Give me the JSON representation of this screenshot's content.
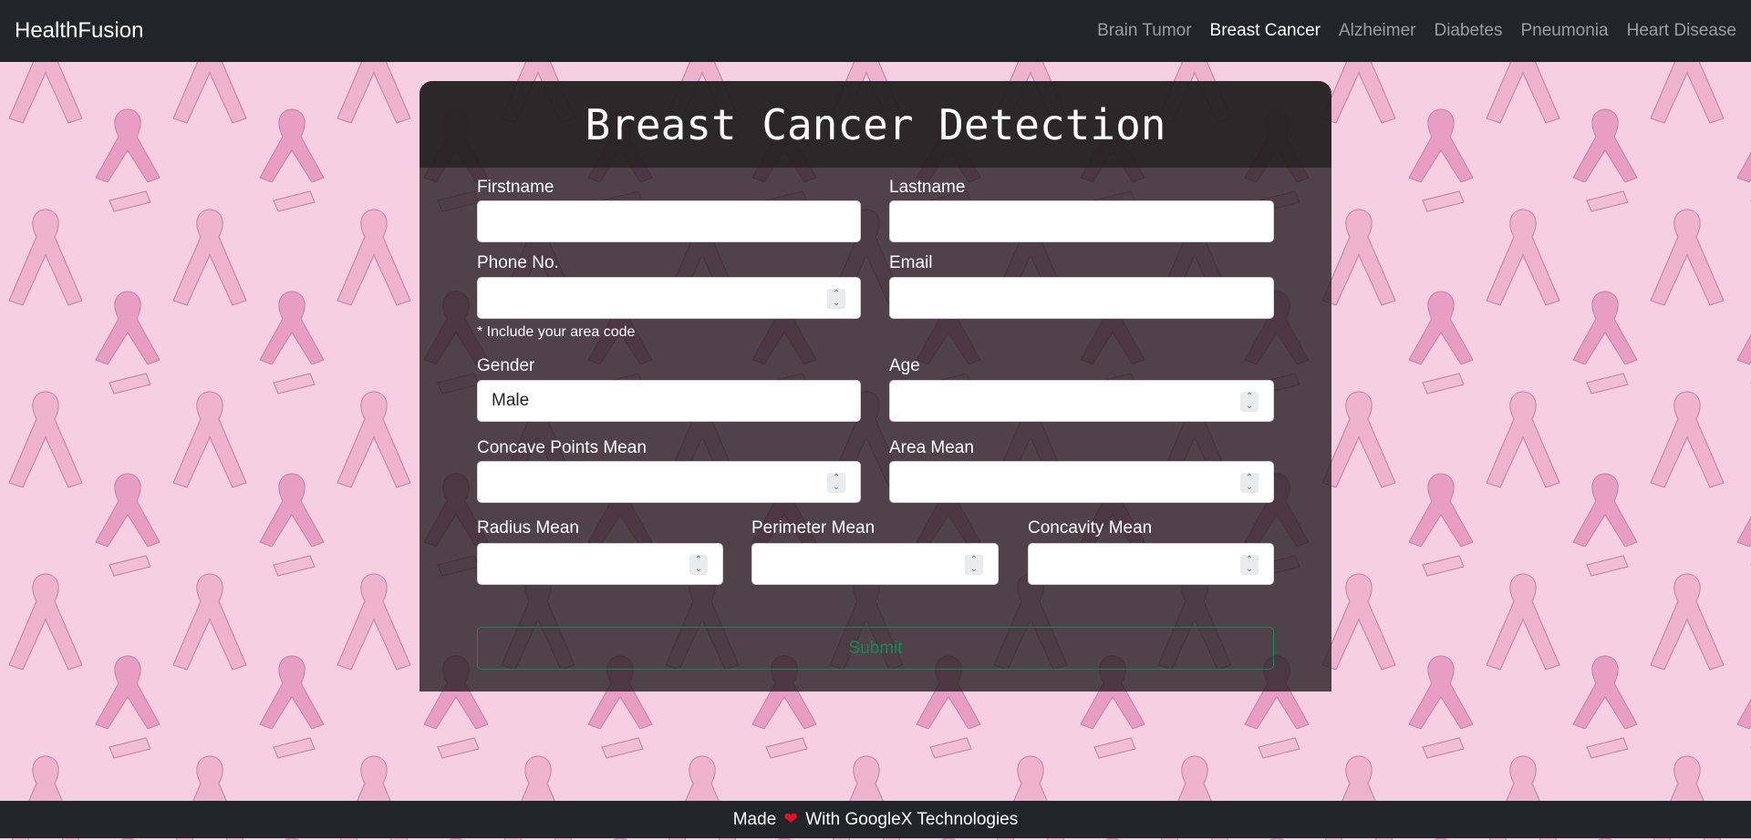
{
  "navbar": {
    "brand": "HealthFusion",
    "links": [
      {
        "label": "Brain Tumor"
      },
      {
        "label": "Breast Cancer",
        "active": true
      },
      {
        "label": "Alzheimer"
      },
      {
        "label": "Diabetes"
      },
      {
        "label": "Pneumonia"
      },
      {
        "label": "Heart Disease"
      }
    ]
  },
  "form": {
    "title": "Breast Cancer Detection",
    "fields": {
      "firstname": {
        "label": "Firstname",
        "value": ""
      },
      "lastname": {
        "label": "Lastname",
        "value": ""
      },
      "phone": {
        "label": "Phone No.",
        "value": "",
        "hint": "* Include your area code"
      },
      "email": {
        "label": "Email",
        "value": ""
      },
      "gender": {
        "label": "Gender",
        "value": "Male"
      },
      "age": {
        "label": "Age",
        "value": ""
      },
      "concave_points_mean": {
        "label": "Concave Points Mean",
        "value": ""
      },
      "area_mean": {
        "label": "Area Mean",
        "value": ""
      },
      "radius_mean": {
        "label": "Radius Mean",
        "value": ""
      },
      "perimeter_mean": {
        "label": "Perimeter Mean",
        "value": ""
      },
      "concavity_mean": {
        "label": "Concavity Mean",
        "value": ""
      }
    },
    "submit_label": "Submit"
  },
  "footer": {
    "made": "Made",
    "heart": "❤",
    "with": "With GoogleX Technologies"
  },
  "colors": {
    "background": "#f6d0e2",
    "ribbon": "#e38fb8",
    "navbar": "#212529",
    "submit": "#198754"
  }
}
